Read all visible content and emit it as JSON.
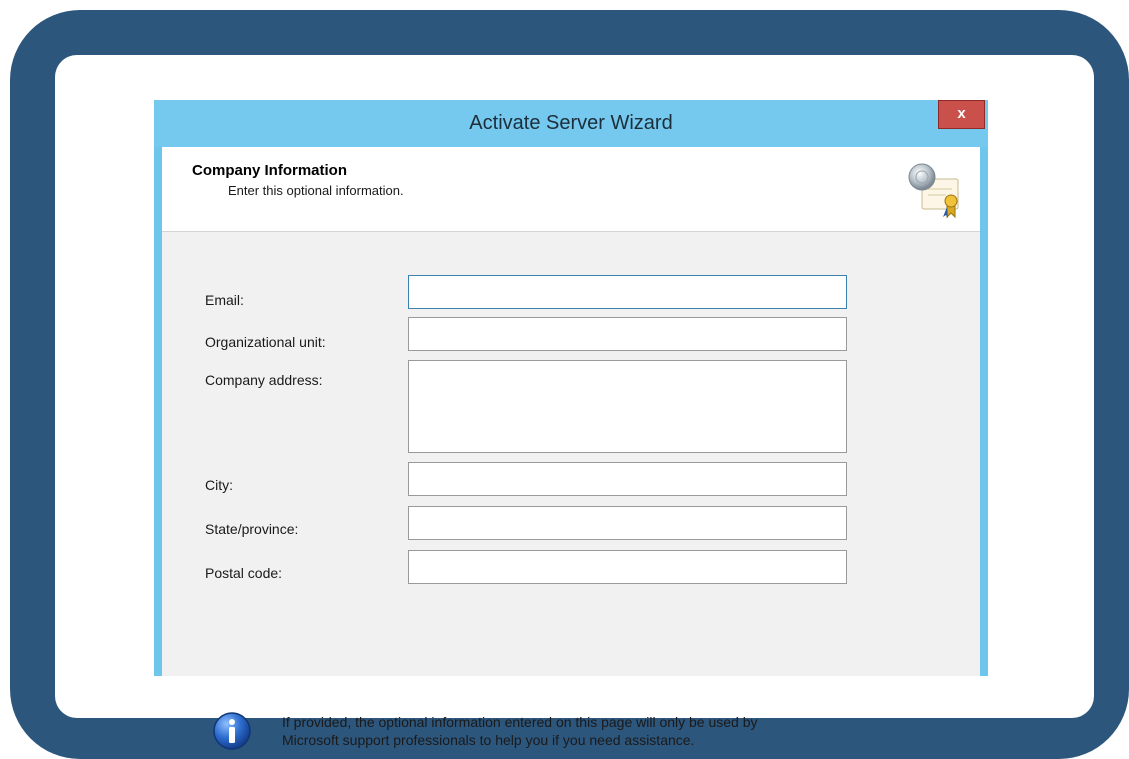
{
  "window": {
    "title": "Activate Server Wizard",
    "close_label": "x"
  },
  "header": {
    "title": "Company Information",
    "subtitle": "Enter this optional information."
  },
  "form": {
    "email_label": "Email:",
    "email_value": "",
    "org_unit_label": "Organizational unit:",
    "org_unit_value": "",
    "address_label": "Company address:",
    "address_value": "",
    "city_label": "City:",
    "city_value": "",
    "state_label": "State/province:",
    "state_value": "",
    "postal_label": "Postal code:",
    "postal_value": ""
  },
  "info": {
    "icon": "info-icon",
    "line1": "If provided, the optional information entered on this page will only be used by",
    "line2": "Microsoft support professionals to help you if you need assistance."
  },
  "colors": {
    "frame": "#2d567d",
    "titlebar": "#75c9ef",
    "close_button": "#c9504b"
  }
}
